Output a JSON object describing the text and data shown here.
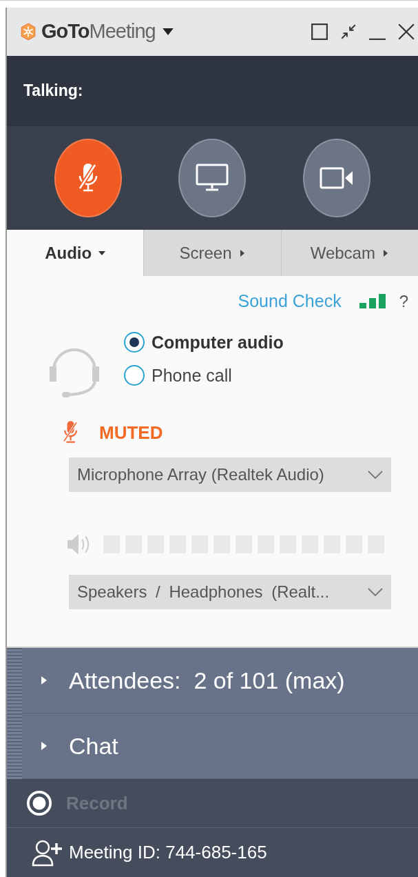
{
  "window": {
    "title": "**GoTo**Meeting"
  },
  "talking": {
    "label": "Talking:"
  },
  "controls": [
    {
      "kind": "microphone",
      "active": true
    },
    {
      "kind": "screen",
      "active": false
    },
    {
      "kind": "webcam",
      "active": false
    }
  ],
  "tabs": [
    {
      "label": "Audio",
      "selected": true
    },
    {
      "label": "Screen",
      "selected": false
    },
    {
      "label": "Webcam",
      "selected": false
    }
  ],
  "audio": {
    "sound_check": "Sound Check",
    "help": "?",
    "options": [
      {
        "label": "Computer audio",
        "selected": true
      },
      {
        "label": "Phone call",
        "selected": false
      }
    ],
    "mute_status": "MUTED",
    "microphone": "Microphone Array (Realtek Audio)",
    "speakers": "Speakers / Headphones (Realt..."
  },
  "panels": [
    {
      "label": "Attendees:  2 of 101 (max)",
      "expanded": false
    },
    {
      "label": "Chat",
      "expanded": false
    }
  ],
  "record": {
    "label": "Record",
    "disabled": true
  },
  "meeting_id": "Meeting ID: 744-685-165"
}
